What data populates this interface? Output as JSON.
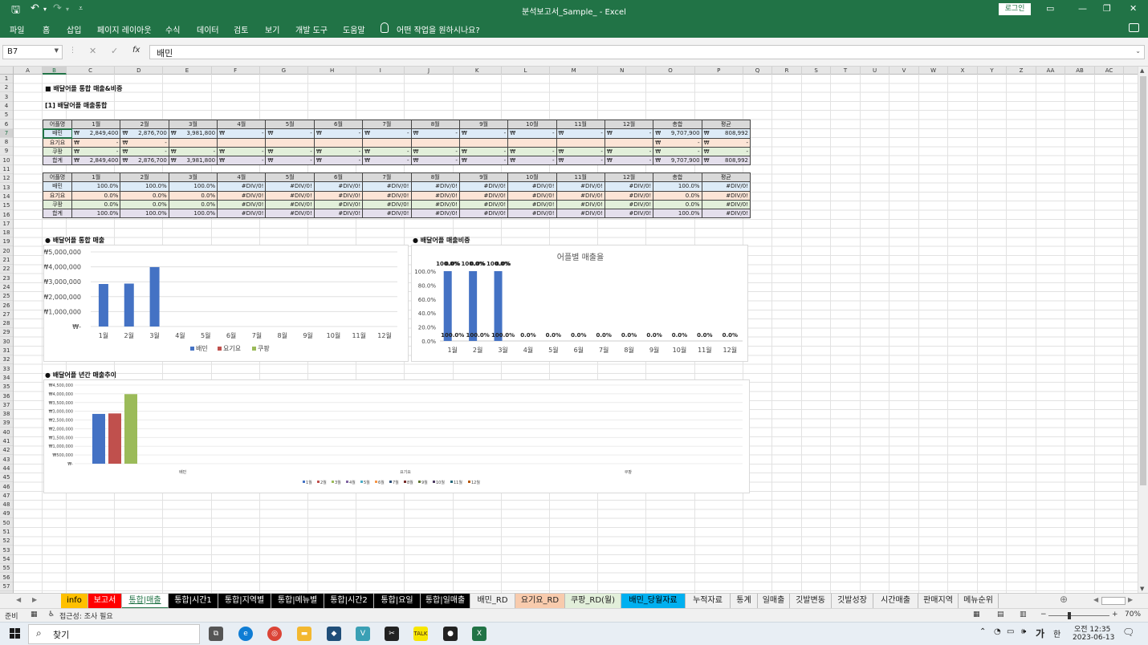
{
  "window": {
    "title": "분석보고서_Sample_  -  Excel",
    "login_label": "로그인"
  },
  "ribbon": {
    "tabs": [
      "파일",
      "홈",
      "삽입",
      "페이지 레이아웃",
      "수식",
      "데이터",
      "검토",
      "보기",
      "개발 도구",
      "도움말"
    ],
    "tell_me": "어떤 작업을 원하시나요?"
  },
  "formula_bar": {
    "name_box": "B7",
    "formula": "배민",
    "fx": "fx"
  },
  "columns": [
    "A",
    "B",
    "C",
    "D",
    "E",
    "F",
    "G",
    "H",
    "I",
    "J",
    "K",
    "L",
    "M",
    "N",
    "O",
    "P",
    "Q",
    "R",
    "S",
    "T",
    "U",
    "V",
    "W",
    "X",
    "Y",
    "Z",
    "AA",
    "AB",
    "AC"
  ],
  "rows": [
    "1",
    "2",
    "3",
    "4",
    "5",
    "6",
    "7",
    "8",
    "9",
    "10",
    "11",
    "12",
    "13",
    "14",
    "15",
    "16",
    "17",
    "18",
    "19",
    "20",
    "21",
    "22",
    "23",
    "24",
    "25",
    "26",
    "27",
    "28",
    "29",
    "30",
    "31",
    "32",
    "33",
    "34",
    "35",
    "36",
    "37",
    "38",
    "39",
    "40",
    "41",
    "42",
    "43",
    "44",
    "45",
    "46",
    "47",
    "48",
    "49",
    "50",
    "51",
    "52",
    "53",
    "54",
    "55",
    "56",
    "57"
  ],
  "sheet": {
    "title": "■ 배달어플 통합 매출&비중",
    "section1": "[1] 배달어플 매출통합",
    "currency": "₩",
    "headers": [
      "어플명",
      "1월",
      "2월",
      "3월",
      "4월",
      "5월",
      "6월",
      "7월",
      "8월",
      "9월",
      "10월",
      "11월",
      "12월",
      "총합",
      "평균"
    ],
    "sales_rows": [
      {
        "name": "배민",
        "vals": [
          "2,849,400",
          "2,876,700",
          "3,981,800",
          "-",
          "-",
          "-",
          "-",
          "-",
          "-",
          "-",
          "-",
          "-",
          "9,707,900",
          "808,992"
        ]
      },
      {
        "name": "요기요",
        "vals": [
          "-",
          "-",
          "",
          "",
          "",
          "",
          "",
          "",
          "",
          "",
          "",
          "",
          "-",
          "-"
        ]
      },
      {
        "name": "쿠팡",
        "vals": [
          "-",
          "-",
          "-",
          "-",
          "-",
          "-",
          "-",
          "-",
          "-",
          "-",
          "-",
          "-",
          "-",
          "-"
        ]
      },
      {
        "name": "합계",
        "vals": [
          "2,849,400",
          "2,876,700",
          "3,981,800",
          "-",
          "-",
          "-",
          "-",
          "-",
          "-",
          "-",
          "-",
          "-",
          "9,707,900",
          "808,992"
        ]
      }
    ],
    "ratio_rows": [
      {
        "name": "배민",
        "vals": [
          "100.0%",
          "100.0%",
          "100.0%",
          "#DIV/0!",
          "#DIV/0!",
          "#DIV/0!",
          "#DIV/0!",
          "#DIV/0!",
          "#DIV/0!",
          "#DIV/0!",
          "#DIV/0!",
          "#DIV/0!",
          "100.0%",
          "#DIV/0!"
        ]
      },
      {
        "name": "요기요",
        "vals": [
          "0.0%",
          "0.0%",
          "0.0%",
          "#DIV/0!",
          "#DIV/0!",
          "#DIV/0!",
          "#DIV/0!",
          "#DIV/0!",
          "#DIV/0!",
          "#DIV/0!",
          "#DIV/0!",
          "#DIV/0!",
          "0.0%",
          "#DIV/0!"
        ]
      },
      {
        "name": "쿠팡",
        "vals": [
          "0.0%",
          "0.0%",
          "0.0%",
          "#DIV/0!",
          "#DIV/0!",
          "#DIV/0!",
          "#DIV/0!",
          "#DIV/0!",
          "#DIV/0!",
          "#DIV/0!",
          "#DIV/0!",
          "#DIV/0!",
          "0.0%",
          "#DIV/0!"
        ]
      },
      {
        "name": "합계",
        "vals": [
          "100.0%",
          "100.0%",
          "100.0%",
          "#DIV/0!",
          "#DIV/0!",
          "#DIV/0!",
          "#DIV/0!",
          "#DIV/0!",
          "#DIV/0!",
          "#DIV/0!",
          "#DIV/0!",
          "#DIV/0!",
          "100.0%",
          "#DIV/0!"
        ]
      }
    ],
    "chart1_caption": "● 배달어플 통합 매출",
    "chart2_caption": "● 배달어플 매출비중",
    "chart3_caption": "● 배달어플 년간 매출추이"
  },
  "chart_data": [
    {
      "type": "bar",
      "title": "",
      "categories": [
        "1월",
        "2월",
        "3월",
        "4월",
        "5월",
        "6월",
        "7월",
        "8월",
        "9월",
        "10월",
        "11월",
        "12월"
      ],
      "series": [
        {
          "name": "배민",
          "color": "#4472c4",
          "values": [
            2849400,
            2876700,
            3981800,
            0,
            0,
            0,
            0,
            0,
            0,
            0,
            0,
            0
          ]
        },
        {
          "name": "요기요",
          "color": "#c0504d",
          "values": [
            0,
            0,
            0,
            0,
            0,
            0,
            0,
            0,
            0,
            0,
            0,
            0
          ]
        },
        {
          "name": "쿠팡",
          "color": "#9bbb59",
          "values": [
            0,
            0,
            0,
            0,
            0,
            0,
            0,
            0,
            0,
            0,
            0,
            0
          ]
        }
      ],
      "yticks": [
        "₩-",
        "₩1,000,000",
        "₩2,000,000",
        "₩3,000,000",
        "₩4,000,000",
        "₩5,000,000"
      ],
      "ylim": [
        0,
        5000000
      ],
      "legend": "bottom"
    },
    {
      "type": "bar",
      "title": "어플별 매출율",
      "categories": [
        "1월",
        "2월",
        "3월",
        "4월",
        "5월",
        "6월",
        "7월",
        "8월",
        "9월",
        "10월",
        "11월",
        "12월"
      ],
      "series": [
        {
          "color": "#4472c4",
          "values": [
            1.0,
            1.0,
            1.0,
            0,
            0,
            0,
            0,
            0,
            0,
            0,
            0,
            0
          ]
        }
      ],
      "top_labels": [
        "100.0%",
        "100.0%",
        "100.0%",
        "",
        "",
        "",
        "",
        "",
        "",
        "",
        "",
        ""
      ],
      "top_labels_overlap": [
        "0.0%",
        "0.0%",
        "0.0%"
      ],
      "bottom_labels": [
        "100.0%",
        "100.0%",
        "100.0%",
        "0.0%",
        "0.0%",
        "0.0%",
        "0.0%",
        "0.0%",
        "0.0%",
        "0.0%",
        "0.0%",
        "0.0%"
      ],
      "yticks": [
        "0.0%",
        "20.0%",
        "40.0%",
        "60.0%",
        "80.0%",
        "100.0%"
      ],
      "ylim": [
        0,
        1
      ]
    },
    {
      "type": "bar",
      "title": "",
      "categories": [
        "배민",
        "요기요",
        "쿠팡"
      ],
      "series": [
        {
          "name": "1월",
          "color": "#4472c4",
          "values": [
            2849400,
            0,
            0
          ]
        },
        {
          "name": "2월",
          "color": "#c0504d",
          "values": [
            2876700,
            0,
            0
          ]
        },
        {
          "name": "3월",
          "color": "#9bbb59",
          "values": [
            3981800,
            0,
            0
          ]
        },
        {
          "name": "4월",
          "color": "#8064a2",
          "values": [
            0,
            0,
            0
          ]
        },
        {
          "name": "5월",
          "color": "#4bacc6",
          "values": [
            0,
            0,
            0
          ]
        },
        {
          "name": "6월",
          "color": "#f79646",
          "values": [
            0,
            0,
            0
          ]
        },
        {
          "name": "7월",
          "color": "#2c4d75",
          "values": [
            0,
            0,
            0
          ]
        },
        {
          "name": "8월",
          "color": "#772c2a",
          "values": [
            0,
            0,
            0
          ]
        },
        {
          "name": "9월",
          "color": "#5f7530",
          "values": [
            0,
            0,
            0
          ]
        },
        {
          "name": "10월",
          "color": "#4d3b62",
          "values": [
            0,
            0,
            0
          ]
        },
        {
          "name": "11월",
          "color": "#276a7c",
          "values": [
            0,
            0,
            0
          ]
        },
        {
          "name": "12월",
          "color": "#b65708",
          "values": [
            0,
            0,
            0
          ]
        }
      ],
      "yticks": [
        "₩-",
        "₩500,000",
        "₩1,000,000",
        "₩1,500,000",
        "₩2,000,000",
        "₩2,500,000",
        "₩3,000,000",
        "₩3,500,000",
        "₩4,000,000",
        "₩4,500,000"
      ],
      "ylim": [
        0,
        4500000
      ],
      "legend": "bottom"
    }
  ],
  "sheet_tabs": [
    {
      "label": "info",
      "bg": "#ffc000",
      "fg": "#000000"
    },
    {
      "label": "보고서",
      "bg": "#ff0000",
      "fg": "#ffffff"
    },
    {
      "label": "통합|매출",
      "bg": "#ffffff",
      "fg": "#217346",
      "active": true
    },
    {
      "label": "통합|시간1",
      "bg": "#000000",
      "fg": "#ffffff"
    },
    {
      "label": "통합|지역별",
      "bg": "#000000",
      "fg": "#ffffff"
    },
    {
      "label": "통합|메뉴별",
      "bg": "#000000",
      "fg": "#ffffff"
    },
    {
      "label": "통합|시간2",
      "bg": "#000000",
      "fg": "#ffffff"
    },
    {
      "label": "통합|요일",
      "bg": "#000000",
      "fg": "#ffffff"
    },
    {
      "label": "통합|일매출",
      "bg": "#000000",
      "fg": "#ffffff"
    },
    {
      "label": "배민_RD",
      "bg": "#f0f0f0",
      "fg": "#222222"
    },
    {
      "label": "요기요_RD",
      "bg": "#f8cbad",
      "fg": "#222222"
    },
    {
      "label": "쿠팡_RD(월)",
      "bg": "#e2efda",
      "fg": "#222222"
    },
    {
      "label": "배민_당월자료",
      "bg": "#00b0f0",
      "fg": "#000000"
    },
    {
      "label": "누적자료",
      "bg": "#f0f0f0",
      "fg": "#222222"
    },
    {
      "label": "통계",
      "bg": "#f0f0f0",
      "fg": "#222222"
    },
    {
      "label": "일매출",
      "bg": "#f0f0f0",
      "fg": "#222222"
    },
    {
      "label": "깃발변동",
      "bg": "#f0f0f0",
      "fg": "#222222"
    },
    {
      "label": "깃발성장",
      "bg": "#f0f0f0",
      "fg": "#222222"
    },
    {
      "label": "시간매출",
      "bg": "#f0f0f0",
      "fg": "#222222"
    },
    {
      "label": "판매지역",
      "bg": "#f0f0f0",
      "fg": "#222222"
    },
    {
      "label": "메뉴순위",
      "bg": "#f0f0f0",
      "fg": "#222222"
    }
  ],
  "status": {
    "ready": "준비",
    "accessibility": "접근성: 조사 필요",
    "zoom": "70%"
  },
  "taskbar": {
    "search": "찾기",
    "time": "오전 12:35",
    "date": "2023-06-13",
    "ime": "가",
    "ime2": "한"
  }
}
